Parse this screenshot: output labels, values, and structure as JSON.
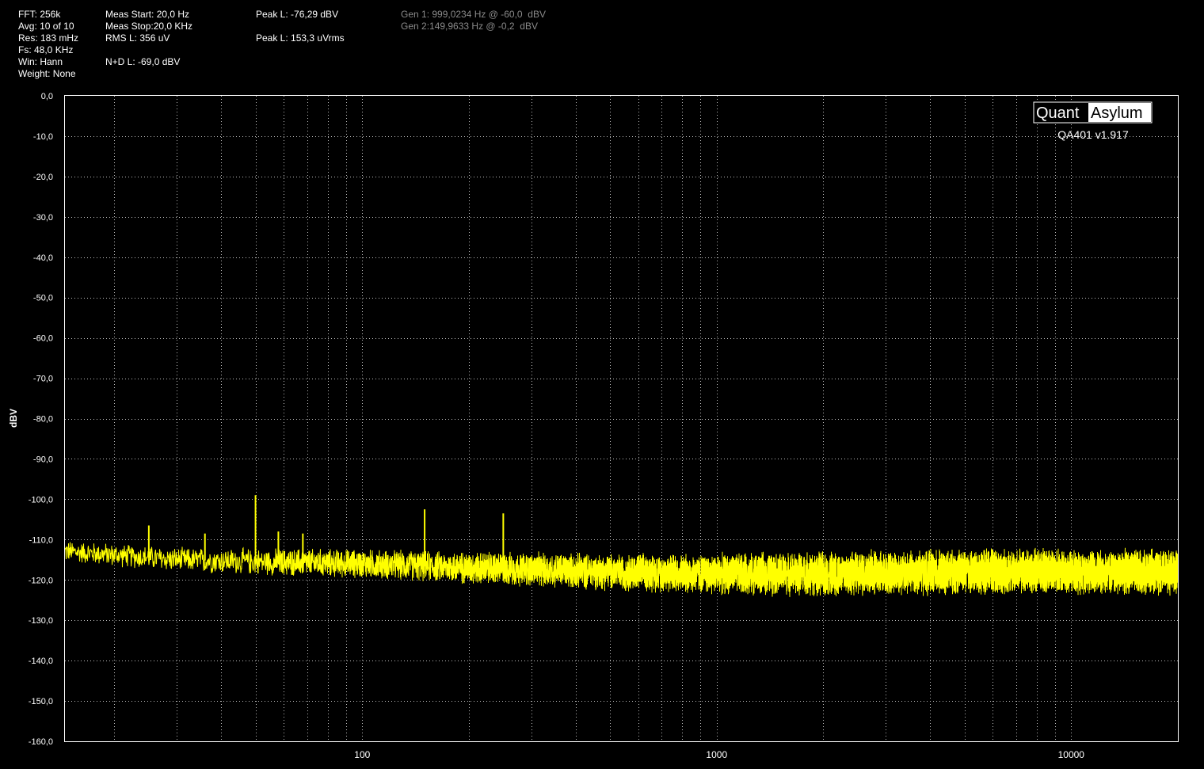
{
  "info": {
    "col1": [
      "FFT: 256k",
      "Avg: 10 of 10",
      "Res: 183 mHz",
      "Fs: 48,0 KHz",
      "Win: Hann",
      "Weight: None"
    ],
    "col2": [
      "Meas Start: 20,0 Hz",
      "Meas Stop:20,0 KHz",
      "RMS L: 356 uV",
      "",
      "N+D L: -69,0 dBV"
    ],
    "col3": [
      "Peak L: -76,29 dBV",
      "",
      "Peak L: 153,3 uVrms"
    ],
    "gen": [
      "Gen 1: 999,0234 Hz @ -60,0  dBV",
      "Gen 2:149,9633 Hz @ -0,2  dBV"
    ]
  },
  "logo": {
    "quant": "Quant",
    "asylum": "Asylum",
    "version": "QA401 v1.917"
  },
  "colors": {
    "background": "#000000",
    "trace": "#ffff00",
    "grid": "#bfbfbf",
    "text": "#ffffff",
    "gen_text": "#8a8a8a"
  },
  "chart_data": {
    "type": "line",
    "title": "",
    "xlabel": "",
    "ylabel": "dBV",
    "x_scale": "log",
    "xlim": [
      14.5,
      20000
    ],
    "ylim": [
      -160,
      0
    ],
    "grid": true,
    "x_ticks": [
      100,
      1000,
      10000
    ],
    "x_tick_labels": [
      "100",
      "1000",
      "10000"
    ],
    "y_ticks": [
      0,
      -10,
      -20,
      -30,
      -40,
      -50,
      -60,
      -70,
      -80,
      -90,
      -100,
      -110,
      -120,
      -130,
      -140,
      -150,
      -160
    ],
    "y_tick_labels": [
      "0,0",
      "-10,0",
      "-20,0",
      "-30,0",
      "-40,0",
      "-50,0",
      "-60,0",
      "-70,0",
      "-80,0",
      "-90,0",
      "-100,0",
      "-110,0",
      "-120,0",
      "-130,0",
      "-140,0",
      "-150,0",
      "-160,0"
    ],
    "series": [
      {
        "color": "#ffff00",
        "noise_floor": {
          "x": [
            15,
            30,
            50,
            100,
            200,
            500,
            1000,
            2000,
            5000,
            10000,
            20000
          ],
          "y": [
            -113,
            -115,
            -115.5,
            -116,
            -117,
            -118,
            -118.5,
            -118.5,
            -118,
            -118,
            -118
          ]
        },
        "noise_spread_db": {
          "x": [
            15,
            100,
            500,
            2000,
            20000
          ],
          "y": [
            3,
            4,
            5,
            6,
            6
          ]
        },
        "peaks": [
          {
            "x": 25,
            "y": -106.5
          },
          {
            "x": 36,
            "y": -108.5
          },
          {
            "x": 50,
            "y": -99
          },
          {
            "x": 58,
            "y": -108
          },
          {
            "x": 68,
            "y": -108.5
          },
          {
            "x": 150,
            "y": -102.5
          },
          {
            "x": 250,
            "y": -103.5
          },
          {
            "x": 1290,
            "y": -114
          },
          {
            "x": 2800,
            "y": -113.5
          },
          {
            "x": 6000,
            "y": -112.5
          }
        ]
      }
    ]
  }
}
